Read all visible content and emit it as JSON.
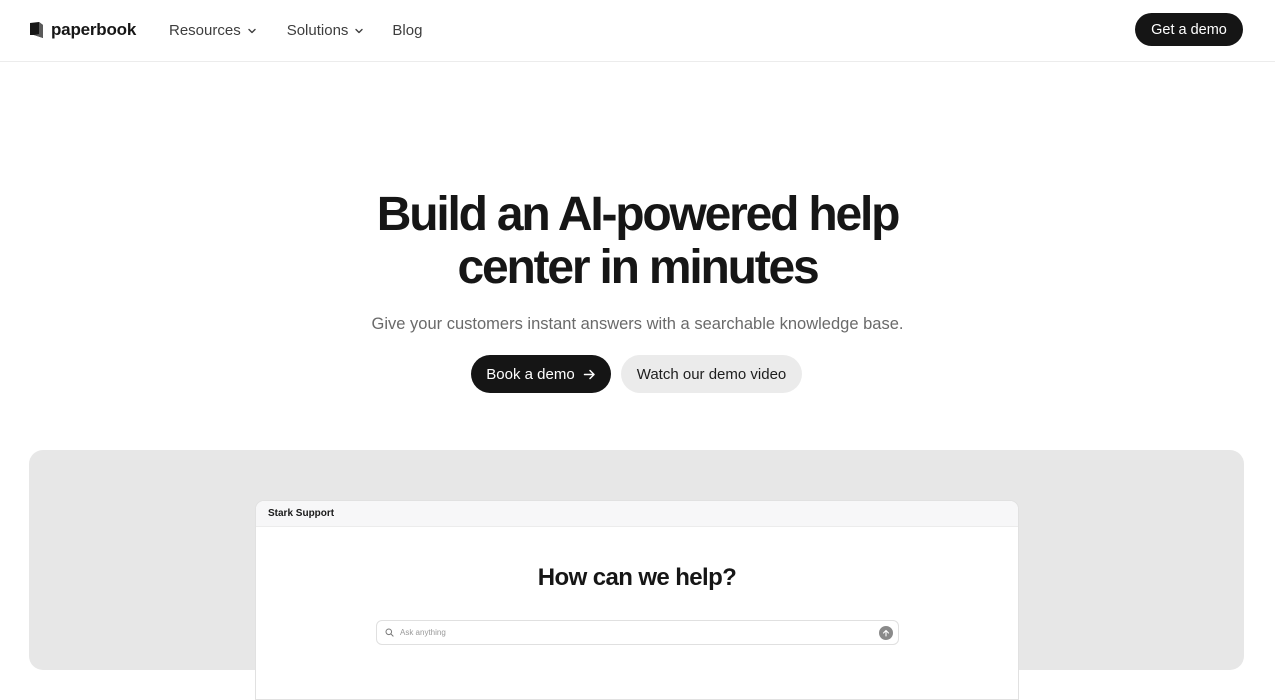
{
  "nav": {
    "logo_text": "paperbook",
    "links": [
      {
        "label": "Resources",
        "has_dropdown": true
      },
      {
        "label": "Solutions",
        "has_dropdown": true
      },
      {
        "label": "Blog",
        "has_dropdown": false
      }
    ],
    "cta_label": "Get a demo"
  },
  "hero": {
    "title_line1": "Build an AI-powered help",
    "title_line2": "center in minutes",
    "subtitle": "Give your customers instant answers with a searchable knowledge base.",
    "primary_button": "Book a demo",
    "secondary_button": "Watch our demo video"
  },
  "preview": {
    "window_title": "Stark Support",
    "heading": "How can we help?",
    "search_placeholder": "Ask anything"
  },
  "icons": {
    "logo": "book-logo-icon",
    "dropdown": "chevron-down-icon",
    "arrow": "arrow-right-icon",
    "search": "search-icon",
    "send": "arrow-up-icon"
  },
  "colors": {
    "primary": "#151515",
    "secondary_button_bg": "#ebebeb",
    "preview_bg": "#e7e7e7",
    "muted_text": "#6a6a6a"
  }
}
